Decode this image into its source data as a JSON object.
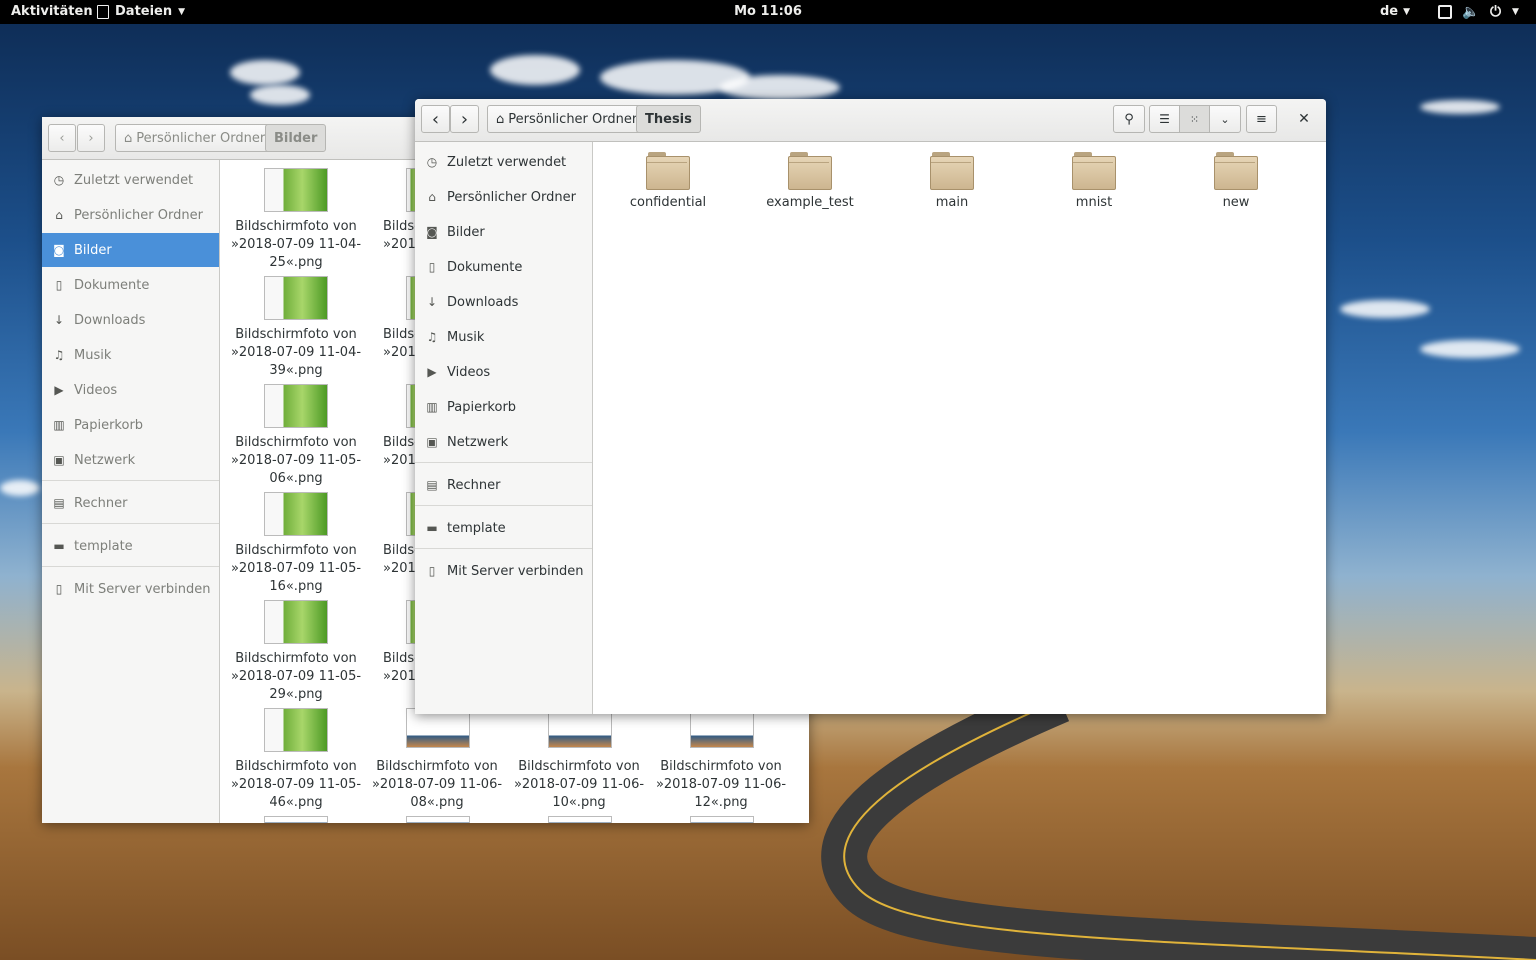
{
  "topbar": {
    "activities": "Aktivitäten",
    "app_menu": "Dateien",
    "clock": "Mo 11:06",
    "lang": "de"
  },
  "back_window": {
    "path": {
      "home": "Persönlicher Ordner",
      "current": "Bilder"
    },
    "sidebar": [
      {
        "label": "Zuletzt verwendet",
        "icon": "clock-icon"
      },
      {
        "label": "Persönlicher Ordner",
        "icon": "home-icon"
      },
      {
        "label": "Bilder",
        "icon": "camera-icon"
      },
      {
        "label": "Dokumente",
        "icon": "document-icon"
      },
      {
        "label": "Downloads",
        "icon": "download-icon"
      },
      {
        "label": "Musik",
        "icon": "music-icon"
      },
      {
        "label": "Videos",
        "icon": "video-icon"
      },
      {
        "label": "Papierkorb",
        "icon": "trash-icon"
      },
      {
        "label": "Netzwerk",
        "icon": "network-icon"
      },
      {
        "label": "Rechner",
        "icon": "computer-icon"
      },
      {
        "label": "template",
        "icon": "folder-icon"
      },
      {
        "label": "Mit Server verbinden",
        "icon": "server-icon"
      }
    ],
    "files_col1": [
      [
        "Bildschirmfoto von",
        "»2018-07-09 11-04-",
        "25«.png"
      ],
      [
        "Bildschirmfoto von",
        "»2018-07-09 11-04-",
        "39«.png"
      ],
      [
        "Bildschirmfoto von",
        "»2018-07-09 11-05-",
        "06«.png"
      ],
      [
        "Bildschirmfoto von",
        "»2018-07-09 11-05-",
        "16«.png"
      ],
      [
        "Bildschirmfoto von",
        "»2018-07-09 11-05-",
        "29«.png"
      ],
      [
        "Bildschirmfoto von",
        "»2018-07-09 11-05-",
        "46«.png"
      ]
    ],
    "files_col2_partial": [
      [
        "Bildsc",
        "»2018"
      ],
      [
        "Bildsc",
        "»2018"
      ],
      [
        "Bildsc",
        "»2018"
      ],
      [
        "Bildsc",
        "»2018"
      ],
      [
        "Bildsc",
        "»2018"
      ]
    ],
    "files_bottom_row": [
      [
        "Bildschirmfoto von",
        "»2018-07-09 11-06-",
        "08«.png"
      ],
      [
        "Bildschirmfoto von",
        "»2018-07-09 11-06-",
        "10«.png"
      ],
      [
        "Bildschirmfoto von",
        "»2018-07-09 11-06-",
        "12«.png"
      ]
    ]
  },
  "front_window": {
    "path": {
      "home": "Persönlicher Ordner",
      "current": "Thesis"
    },
    "sidebar": [
      {
        "label": "Zuletzt verwendet",
        "icon": "clock-icon"
      },
      {
        "label": "Persönlicher Ordner",
        "icon": "home-icon"
      },
      {
        "label": "Bilder",
        "icon": "camera-icon"
      },
      {
        "label": "Dokumente",
        "icon": "document-icon"
      },
      {
        "label": "Downloads",
        "icon": "download-icon"
      },
      {
        "label": "Musik",
        "icon": "music-icon"
      },
      {
        "label": "Videos",
        "icon": "video-icon"
      },
      {
        "label": "Papierkorb",
        "icon": "trash-icon"
      },
      {
        "label": "Netzwerk",
        "icon": "network-icon"
      },
      {
        "label": "Rechner",
        "icon": "computer-icon"
      },
      {
        "label": "template",
        "icon": "folder-icon"
      },
      {
        "label": "Mit Server verbinden",
        "icon": "server-icon"
      }
    ],
    "folders": [
      "confidential",
      "example_test",
      "main",
      "mnist",
      "new"
    ]
  }
}
